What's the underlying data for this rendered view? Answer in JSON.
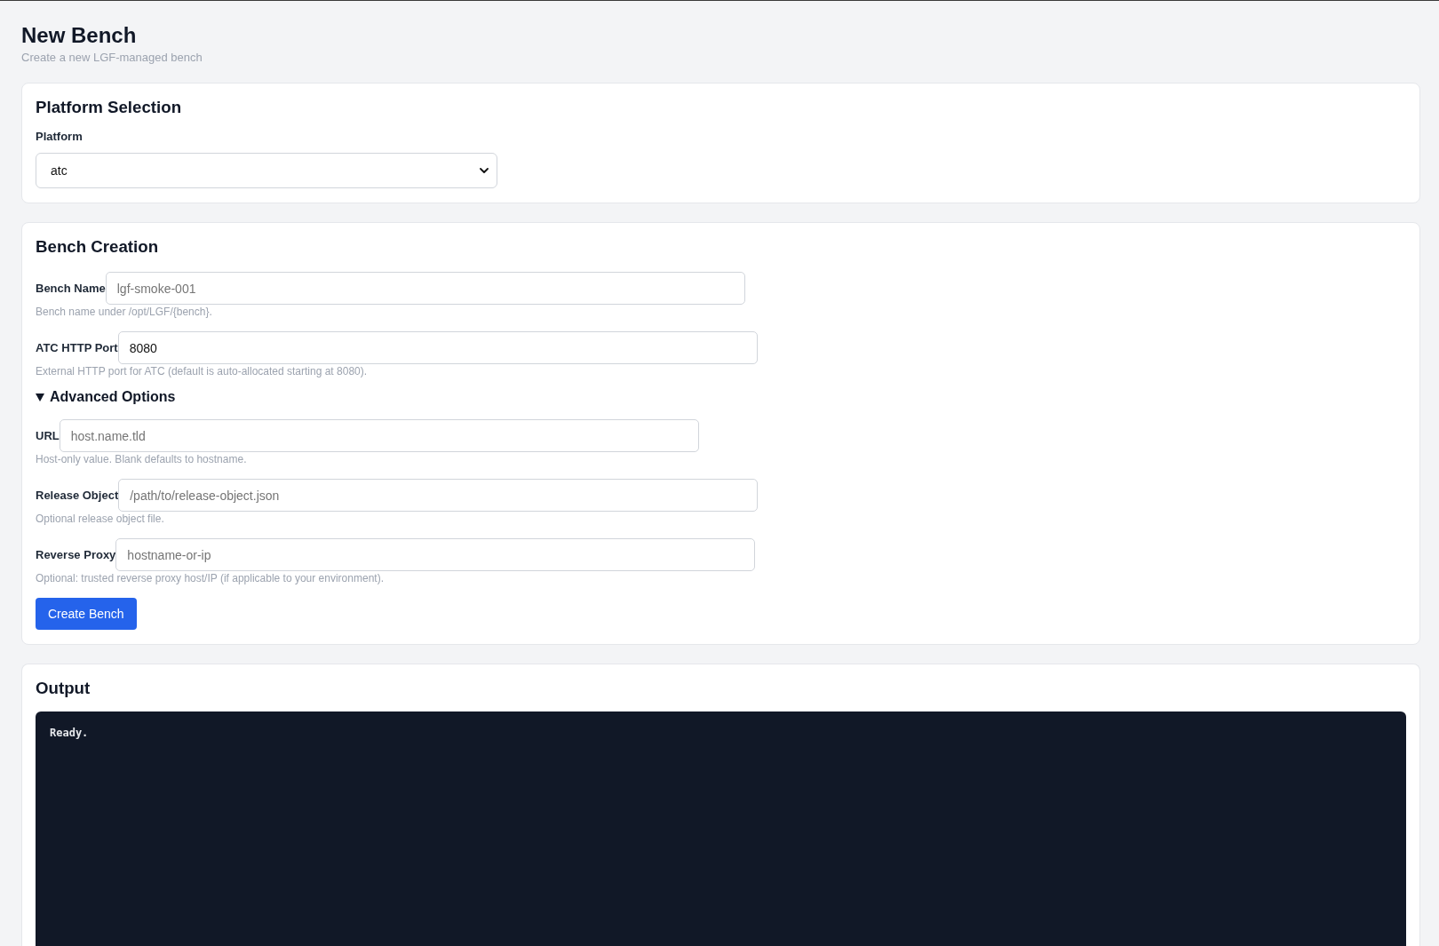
{
  "page": {
    "title": "New Bench",
    "subtitle": "Create a new LGF-managed bench"
  },
  "platform_selection": {
    "title": "Platform Selection",
    "platform": {
      "label": "Platform",
      "value": "atc"
    }
  },
  "bench_creation": {
    "title": "Bench Creation",
    "fields": [
      {
        "label": "Bench Name",
        "placeholder": "lgf-smoke-001",
        "help": "Bench name under /opt/LGF/{bench}."
      },
      {
        "label": "ATC HTTP Port",
        "value": "8080",
        "help": "External HTTP port for ATC (default is auto-allocated starting at 8080)."
      }
    ],
    "advanced_options": {
      "label": "Advanced Options",
      "expanded": true,
      "fields": [
        {
          "label": "URL",
          "placeholder": "host.name.tld",
          "help": "Host-only value. Blank defaults to hostname."
        },
        {
          "label": "Release Object",
          "placeholder": "/path/to/release-object.json",
          "help": "Optional release object file."
        },
        {
          "label": "Reverse Proxy",
          "placeholder": "hostname-or-ip",
          "help": "Optional: trusted reverse proxy host/IP (if applicable to your environment)."
        }
      ]
    },
    "submit_button": "Create Bench"
  },
  "output": {
    "title": "Output",
    "text": "Ready."
  }
}
